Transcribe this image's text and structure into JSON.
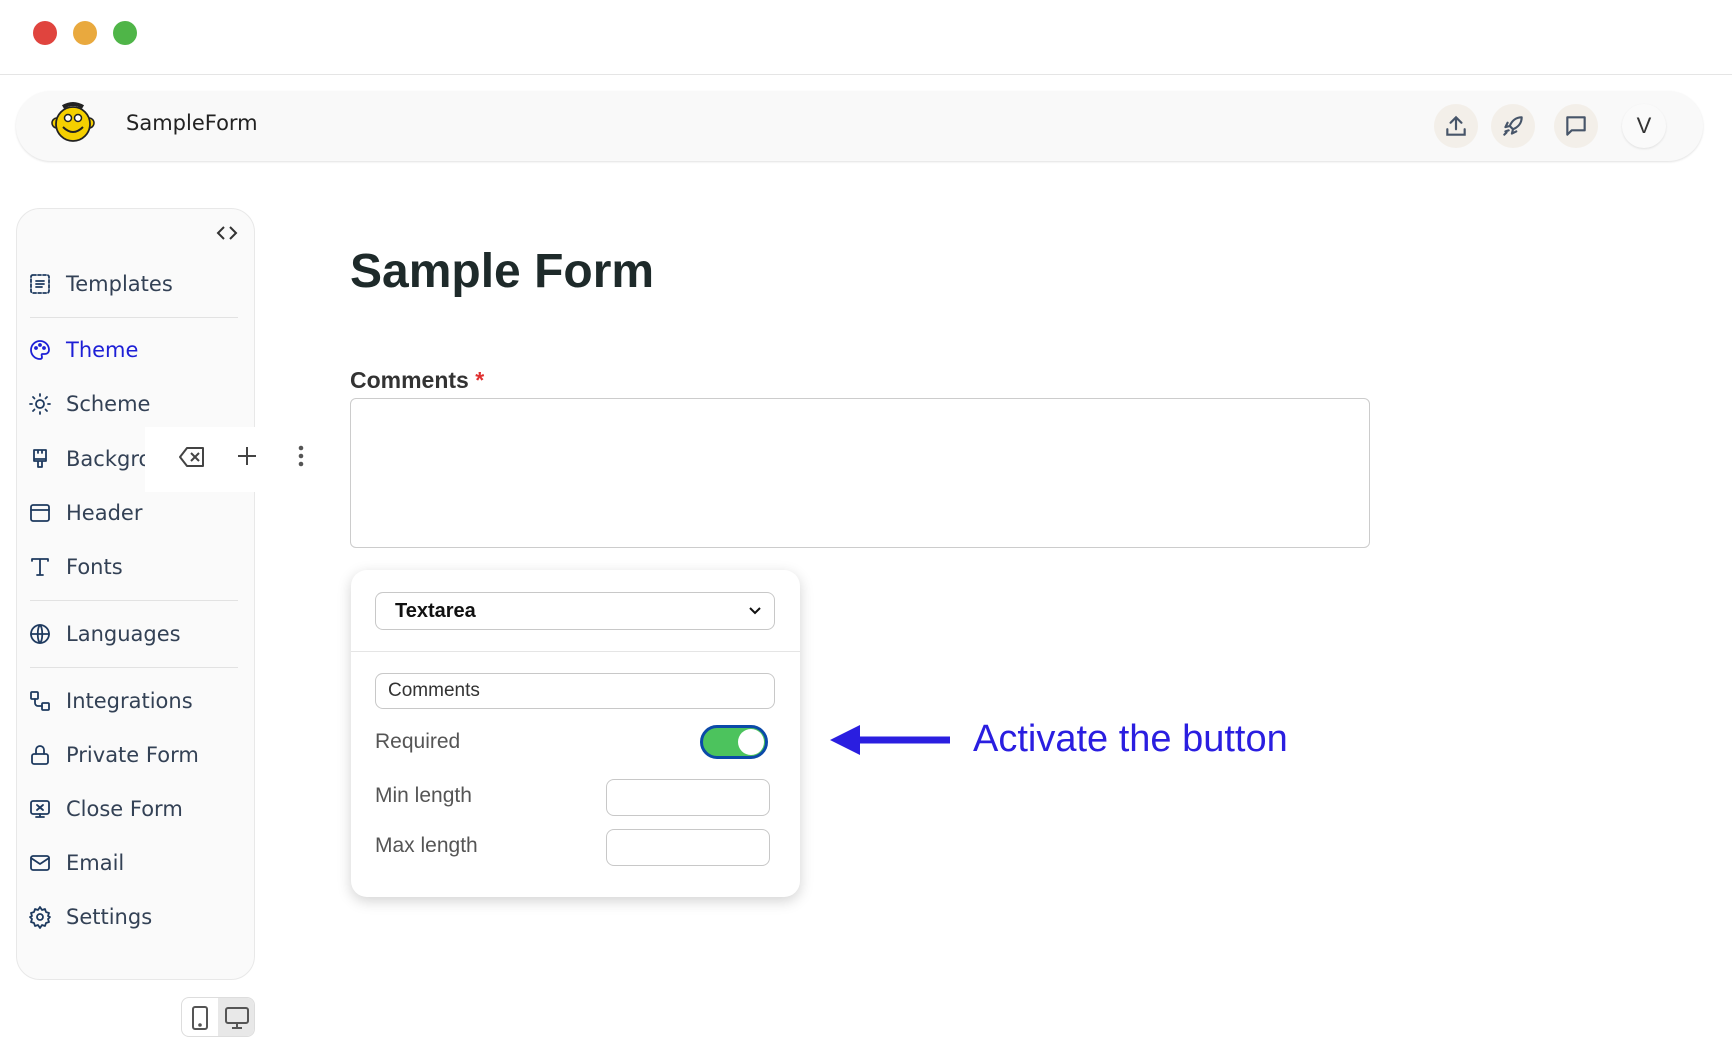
{
  "window": {
    "controls": [
      "close",
      "minimize",
      "maximize"
    ],
    "colors": {
      "close": "#e0443e",
      "minimize": "#e9a93e",
      "maximize": "#4fb548"
    }
  },
  "header": {
    "app_title": "SampleForm",
    "logo": "monkey-logo",
    "actions": [
      {
        "icon": "upload-icon"
      },
      {
        "icon": "rocket-icon"
      },
      {
        "icon": "comment-icon"
      }
    ],
    "avatar": "V"
  },
  "sidebar": {
    "items": [
      {
        "label": "Templates",
        "icon": "templates-icon"
      },
      {
        "label": "Theme",
        "icon": "palette-icon",
        "active": true
      },
      {
        "label": "Scheme",
        "icon": "sun-moon-icon"
      },
      {
        "label": "Backgro",
        "icon": "brush-icon"
      },
      {
        "label": "Header",
        "icon": "header-icon"
      },
      {
        "label": "Fonts",
        "icon": "font-icon"
      },
      {
        "label": "Languages",
        "icon": "globe-icon"
      },
      {
        "label": "Integrations",
        "icon": "integrations-icon"
      },
      {
        "label": "Private Form",
        "icon": "lock-icon"
      },
      {
        "label": "Close Form",
        "icon": "close-form-icon"
      },
      {
        "label": "Email",
        "icon": "mail-icon"
      },
      {
        "label": "Settings",
        "icon": "gear-icon"
      }
    ],
    "accent": "#1d1fd6"
  },
  "form": {
    "title": "Sample Form",
    "field_label": "Comments",
    "required_mark": "*"
  },
  "popover": {
    "type_select": "Textarea",
    "label_value": "Comments",
    "required_label": "Required",
    "required_on": true,
    "min_label": "Min length",
    "min_value": "",
    "max_label": "Max length",
    "max_value": "",
    "toggle_color": "#4cc35d"
  },
  "annotation": {
    "text": "Activate the button",
    "color": "#2a1ee0"
  }
}
